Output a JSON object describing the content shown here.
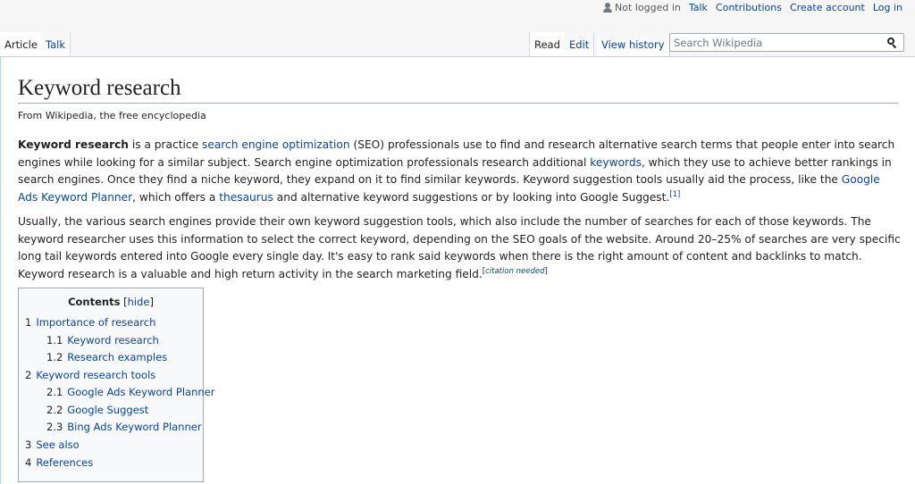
{
  "personal": {
    "not_logged_in": "Not logged in",
    "talk": "Talk",
    "contributions": "Contributions",
    "create_account": "Create account",
    "log_in": "Log in"
  },
  "tabs": {
    "article": "Article",
    "talk": "Talk",
    "read": "Read",
    "edit": "Edit",
    "view_history": "View history"
  },
  "search": {
    "placeholder": "Search Wikipedia"
  },
  "article": {
    "title": "Keyword research",
    "tagline": "From Wikipedia, the free encyclopedia",
    "p1": {
      "bold": "Keyword research",
      "t1": " is a practice ",
      "l1": "search engine optimization",
      "t2": " (SEO) professionals use to find and research alternative search terms that people enter into search engines while looking for a similar subject. Search engine optimization professionals research additional ",
      "l2": "keywords",
      "t3": ", which they use to achieve better rankings in search engines. Once they find a niche keyword, they expand on it to find similar keywords. Keyword suggestion tools usually aid the process, like the ",
      "l3": "Google Ads Keyword Planner",
      "t4": ", which offers a ",
      "l4": "thesaurus",
      "t5": " and alternative keyword suggestions or by looking into Google Suggest.",
      "ref": "[1]"
    },
    "p2": {
      "text": "Usually, the various search engines provide their own keyword suggestion tools, which also include the number of searches for each of those keywords. The keyword researcher uses this information to select the correct keyword, depending on the SEO goals of the website. Around 20–25% of searches are very specific long tail keywords entered into Google every single day. It's easy to rank said keywords when there is the right amount of content and backlinks to match. Keyword research is a valuable and high return activity in the search marketing field.",
      "cite_open": "[",
      "cite_text": "citation needed",
      "cite_close": "]"
    }
  },
  "toc": {
    "title": "Contents",
    "hide_open": " [",
    "hide": "hide",
    "hide_close": "]",
    "items": [
      {
        "num": "1",
        "label": "Importance of research"
      },
      {
        "num": "1.1",
        "label": "Keyword research"
      },
      {
        "num": "1.2",
        "label": "Research examples"
      },
      {
        "num": "2",
        "label": "Keyword research tools"
      },
      {
        "num": "2.1",
        "label": "Google Ads Keyword Planner"
      },
      {
        "num": "2.2",
        "label": "Google Suggest"
      },
      {
        "num": "2.3",
        "label": "Bing Ads Keyword Planner"
      },
      {
        "num": "3",
        "label": "See also"
      },
      {
        "num": "4",
        "label": "References"
      }
    ]
  }
}
